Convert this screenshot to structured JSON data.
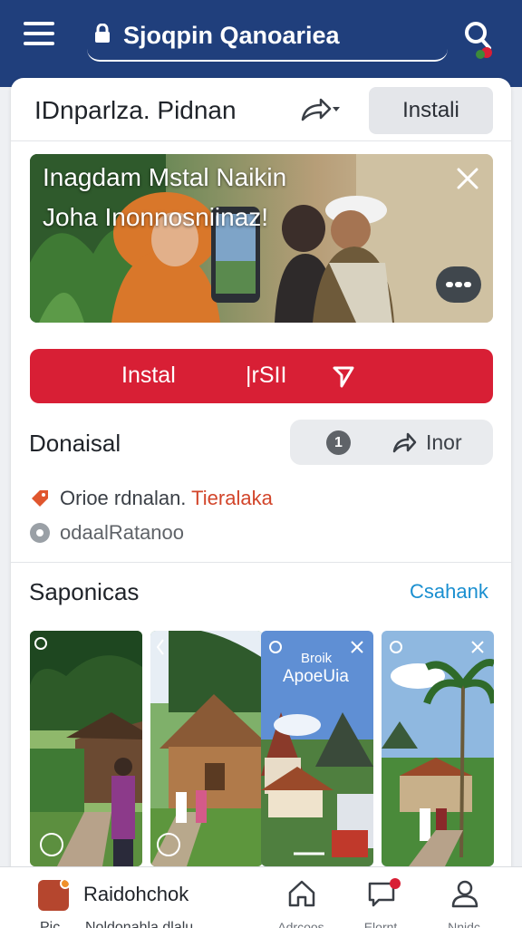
{
  "top_bar": {
    "url_text": "Sjoqpin Qanoariea",
    "menu_icon": "hamburger-menu-icon",
    "lock_icon": "lock-icon",
    "search_icon": "search-icon",
    "background_color": "#203f7c"
  },
  "app_header": {
    "app_name": "IDnparlza. Pidnan",
    "share_icon": "share-icon",
    "install_label": "Instali"
  },
  "banner": {
    "line1": "Inagdam Mstal Naikin",
    "line2": "Joha Inonnosniinaz!",
    "close_icon": "close-icon",
    "more_icon": "more-options-icon"
  },
  "primary_action": {
    "label_left": "Instal",
    "label_right": "|rSII",
    "icon": "send-icon",
    "color": "#d81f35"
  },
  "details": {
    "title": "Donaisal",
    "count": "1",
    "forward_label": "Inor",
    "forward_icon": "forward-arrow-icon",
    "info_line1_text": "Orioe rdnalan.",
    "info_line1_accent": "Tieralaka",
    "info_line1_icon": "tag-icon",
    "info_line2_text": "odaalRatanoo",
    "info_line2_icon": "info-circle-icon",
    "accent_color": "#d2452a"
  },
  "gallery": {
    "title": "Saponicas",
    "see_all_label": "Csahank",
    "tiles": [
      {
        "name": "village-photo-1"
      },
      {
        "name": "village-photo-2"
      },
      {
        "name": "village-photo-3",
        "caption_line1": "Broik",
        "caption_line2": "ApoeUia"
      },
      {
        "name": "village-photo-4"
      }
    ]
  },
  "bottom_nav": {
    "brand_name": "Raidohchok",
    "brand_sub_left": "Pic",
    "brand_sub_mid": "Noldonahla.dlalu",
    "items": [
      {
        "label": "Adrcoos",
        "icon": "home-icon"
      },
      {
        "label": "Elornt",
        "icon": "chat-bubble-icon",
        "badge": true
      },
      {
        "label": "Nnidc",
        "icon": "profile-icon"
      }
    ]
  }
}
